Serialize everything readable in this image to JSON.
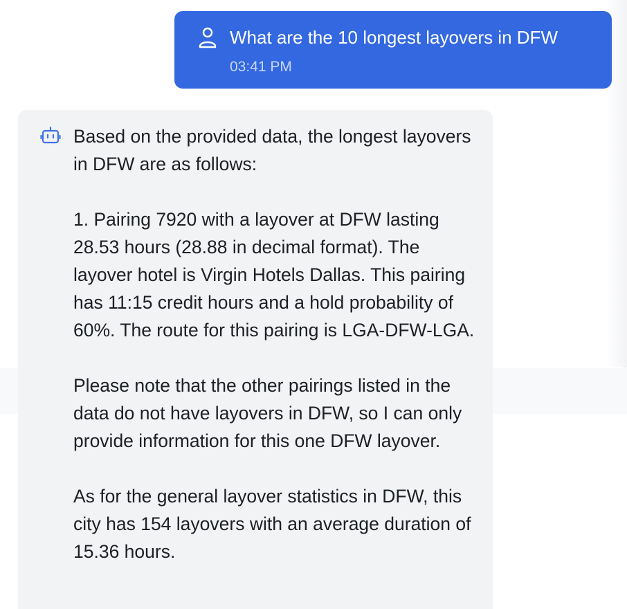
{
  "user_message": {
    "text": "What are the 10 longest layovers in DFW",
    "time": "03:41 PM"
  },
  "bot_message": {
    "paragraphs": [
      "Based on the provided data, the longest layovers in DFW are as follows:",
      "1. Pairing 7920 with a layover at DFW lasting 28.53 hours (28.88 in decimal format). The layover hotel is Virgin Hotels Dallas. This pairing has 11:15 credit hours and a hold probability of 60%. The route for this pairing is LGA-DFW-LGA.",
      "Please note that the other pairings listed in the data do not have layovers in DFW, so I can only provide information for this one DFW layover.",
      "As for the general layover statistics in DFW, this city has 154 layovers with an average duration of 15.36 hours."
    ]
  },
  "icons": {
    "user": "user-icon",
    "bot": "bot-icon"
  },
  "colors": {
    "user_bubble": "#3368e0",
    "bot_bubble": "#f2f3f5",
    "bot_icon": "#3f72e6"
  }
}
